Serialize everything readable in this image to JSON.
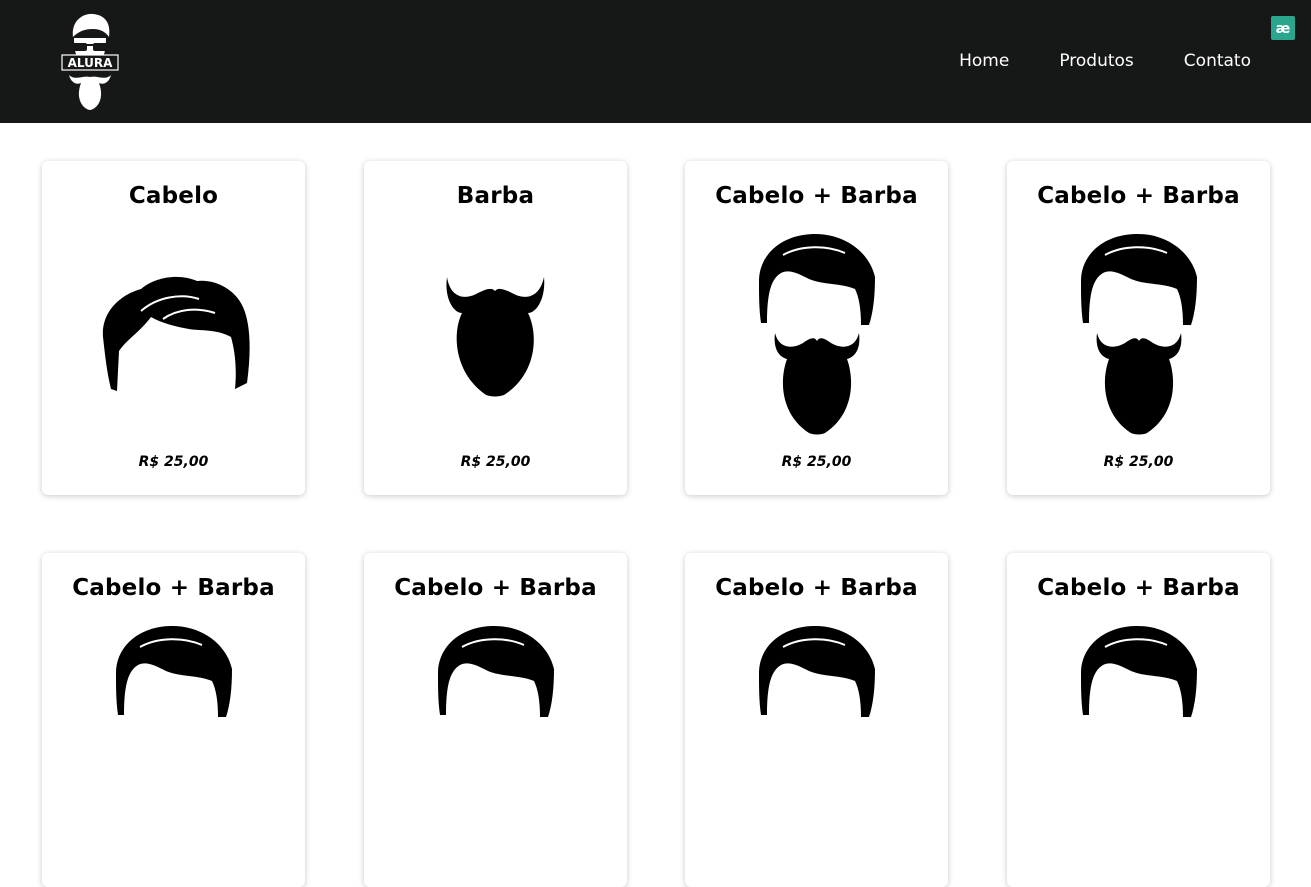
{
  "header": {
    "logo_text": "ALURA",
    "nav": [
      "Home",
      "Produtos",
      "Contato"
    ],
    "extension_icon": "ae-icon"
  },
  "products": [
    {
      "title": "Cabelo",
      "price": "R$ 25,00",
      "image": "hair-icon"
    },
    {
      "title": "Barba",
      "price": "R$ 25,00",
      "image": "beard-icon"
    },
    {
      "title": "Cabelo + Barba",
      "price": "R$ 25,00",
      "image": "hair-and-beard-icon"
    },
    {
      "title": "Cabelo + Barba",
      "price": "R$ 25,00",
      "image": "hair-and-beard-icon"
    },
    {
      "title": "Cabelo + Barba",
      "price": "",
      "image": "hair-and-beard-icon"
    },
    {
      "title": "Cabelo + Barba",
      "price": "",
      "image": "hair-and-beard-icon"
    },
    {
      "title": "Cabelo + Barba",
      "price": "",
      "image": "hair-and-beard-icon"
    },
    {
      "title": "Cabelo + Barba",
      "price": "",
      "image": "hair-and-beard-icon"
    }
  ],
  "colors": {
    "header_bg": "#161717",
    "accent": "#2aa58e"
  }
}
